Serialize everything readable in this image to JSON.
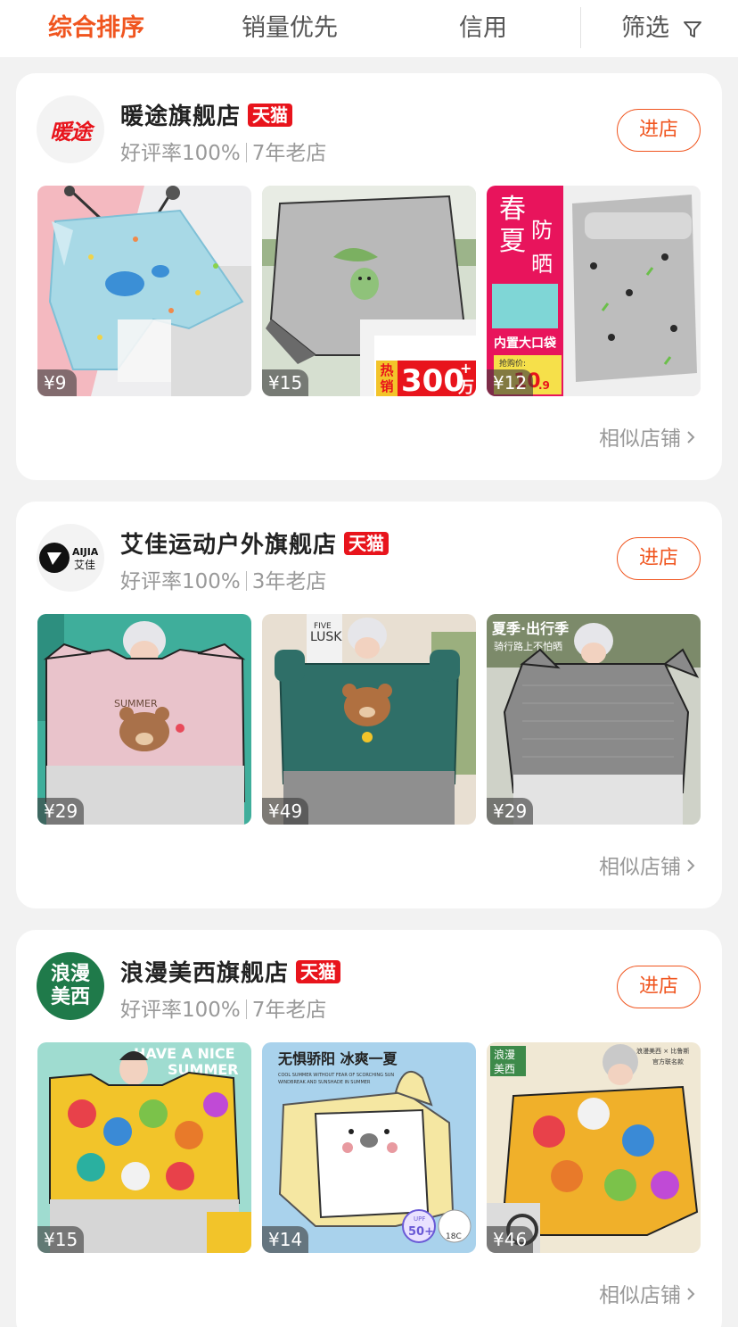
{
  "sort_bar": {
    "tabs": [
      {
        "label": "综合排序",
        "active": true
      },
      {
        "label": "销量优先",
        "active": false
      },
      {
        "label": "信用",
        "active": false
      }
    ],
    "filter_label": "筛选",
    "filter_icon": "funnel-icon",
    "accent_color": "#f0551f"
  },
  "shops": [
    {
      "logo_text": "暖途",
      "name": "暖途旗舰店",
      "badge": "天猫",
      "rating": "好评率100%",
      "age": "7年老店",
      "enter_label": "进店",
      "products": [
        {
          "price": "¥9"
        },
        {
          "price": "¥15"
        },
        {
          "price": "¥12"
        }
      ],
      "promo_text": {
        "hot": "热",
        "sell": "销",
        "count": "300",
        "plus": "+",
        "unit": "万",
        "spring": "春",
        "summer": "夏",
        "guard": "防",
        "sun": "晒",
        "pocket": "内置大口袋",
        "promo_price_label": "抢购价:",
        "promo_price": "10",
        "promo_price_cents": ".9"
      },
      "similar_label": "相似店铺"
    },
    {
      "logo_text": "AIJIA 艾佳",
      "logo_brand": "AIJIA",
      "logo_cn": "艾佳",
      "name": "艾佳运动户外旗舰店",
      "badge": "天猫",
      "rating": "好评率100%",
      "age": "3年老店",
      "enter_label": "进店",
      "products": [
        {
          "price": "¥29"
        },
        {
          "price": "¥49"
        },
        {
          "price": "¥29"
        }
      ],
      "promo_text": {
        "summer": "SUMMER",
        "lusk": "LUSK",
        "five": "FIVE",
        "banner": "夏季·出行季",
        "banner_sub": "骑行路上不怕晒"
      },
      "similar_label": "相似店铺"
    },
    {
      "logo_text": "浪漫美西",
      "logo_line1": "浪漫",
      "logo_line2": "美西",
      "name": "浪漫美西旗舰店",
      "badge": "天猫",
      "rating": "好评率100%",
      "age": "7年老店",
      "enter_label": "进店",
      "products": [
        {
          "price": "¥15"
        },
        {
          "price": "¥14"
        },
        {
          "price": "¥46"
        }
      ],
      "promo_text": {
        "have": "HAVE A NICE",
        "summer": "SUMMER",
        "headline": "无惧骄阳 冰爽一夏",
        "sub1": "COOL SUMMER WITHOUT FEAR OF SCORCHING SUN",
        "sub2": "WINDBREAK AND SUNSHADE IN SUMMER",
        "upf": "50+",
        "upf_label": "UPF",
        "temp": "18C",
        "corner1": "浪漫",
        "corner2": "美西",
        "collab": "浪漫美西 × 比鲁斯",
        "collab2": "官方联名款"
      },
      "similar_label": "相似店铺"
    }
  ]
}
